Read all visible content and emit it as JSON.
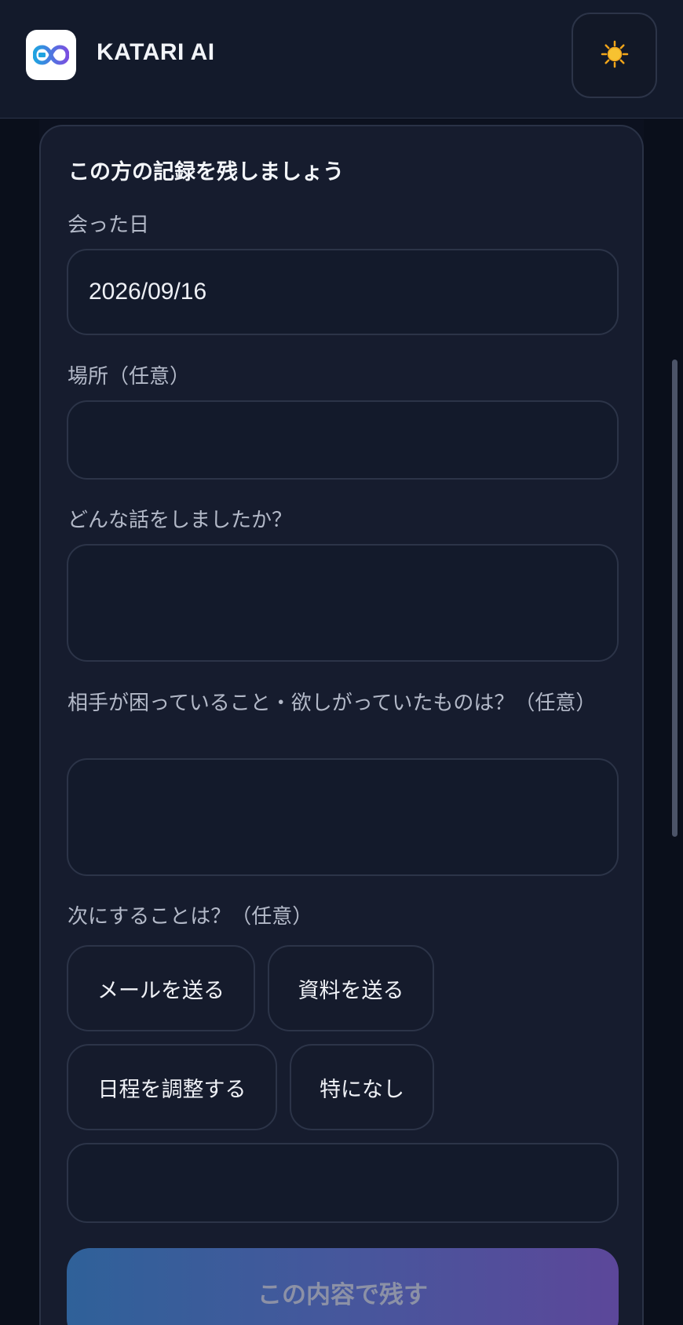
{
  "header": {
    "app_title": "KATARI AI",
    "logo_icon": "infinity-logo-icon",
    "theme_icon": "sun-icon"
  },
  "form": {
    "title": "この方の記録を残しましょう",
    "date_label": "会った日",
    "date_value": "2026/09/16",
    "place_label": "場所（任意）",
    "place_value": "",
    "topic_label": "どんな話をしましたか？",
    "topic_value": "",
    "needs_label": "相手が困っていること・欲しがっていたものは？（任意）",
    "needs_value": "",
    "next_label": "次にすることは？（任意）",
    "next_options": [
      "メールを送る",
      "資料を送る",
      "日程を調整する",
      "特になし"
    ],
    "next_custom_value": "",
    "submit_label": "この内容で残す"
  },
  "colors": {
    "background": "#0c111f",
    "card": "#161c2e",
    "gradient_start": "#2f6199",
    "gradient_end": "#5c479a"
  }
}
